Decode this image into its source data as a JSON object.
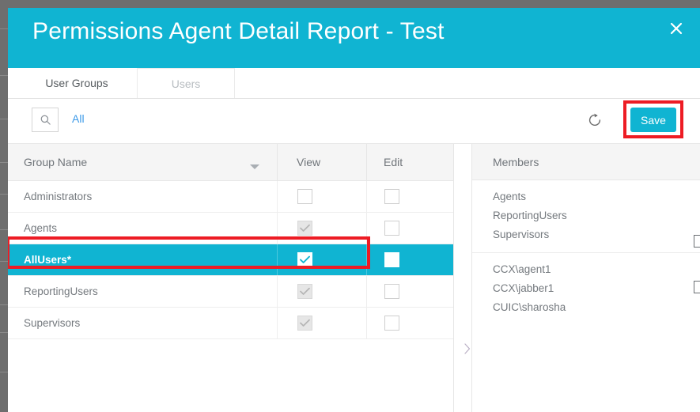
{
  "colors": {
    "accent": "#10B4D2",
    "annotation": "#ED1C24",
    "link": "#3D9AE8",
    "header_bg": "#F5F5F5",
    "backdrop": "#6E6E6E"
  },
  "dialog": {
    "title": "Permissions Agent Detail Report - Test",
    "close_label": "×"
  },
  "tabs": [
    {
      "label": "User Groups",
      "active": true
    },
    {
      "label": "Users",
      "active": false
    }
  ],
  "toolbar": {
    "search_icon": "search-icon",
    "all_label": "All",
    "refresh_icon": "refresh-icon",
    "save_label": "Save"
  },
  "grid": {
    "columns": [
      "Group Name",
      "View",
      "Edit"
    ],
    "sort_indicator": "chevron-down-icon",
    "rows": [
      {
        "name": "Administrators",
        "view": "empty",
        "edit": "empty",
        "selected": false
      },
      {
        "name": "Agents",
        "view": "disabled",
        "edit": "empty",
        "selected": false
      },
      {
        "name": "AllUsers*",
        "view": "checked",
        "edit": "white",
        "selected": true
      },
      {
        "name": "ReportingUsers",
        "view": "disabled",
        "edit": "empty",
        "selected": false
      },
      {
        "name": "Supervisors",
        "view": "disabled",
        "edit": "empty",
        "selected": false
      }
    ]
  },
  "expander": {
    "icon": "chevron-right-icon"
  },
  "members": {
    "header": "Members",
    "groups": [
      [
        "Agents",
        "ReportingUsers",
        "Supervisors"
      ],
      [
        "CCX\\agent1",
        "CCX\\jabber1",
        "CUIC\\sharosha"
      ]
    ]
  }
}
